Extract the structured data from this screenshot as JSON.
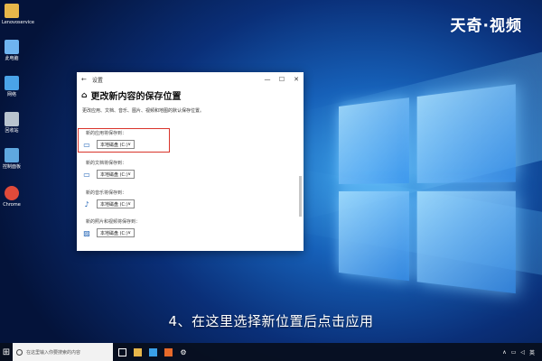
{
  "brand": "天奇·视频",
  "desktop_icons": [
    {
      "label": "Lenovoservice",
      "color": "#e8b74a"
    },
    {
      "label": "此电脑",
      "color": "#6fb4f0"
    },
    {
      "label": "网络",
      "color": "#4aa3e8"
    },
    {
      "label": "回收站",
      "color": "#b9c4cf"
    },
    {
      "label": "控制面板",
      "color": "#5fa8e0"
    },
    {
      "label": "Chrome",
      "color": "#e04a3a"
    }
  ],
  "window": {
    "title": "设置",
    "heading": "更改新内容的保存位置",
    "description": "更改应用、文档、音乐、图片、视频和地图的默认保存位置。",
    "sections": [
      {
        "label": "新的应用将保存到：",
        "value": "本地磁盘 (C:)",
        "icon": "monitor-icon"
      },
      {
        "label": "新的文档将保存到：",
        "value": "本地磁盘 (C:)",
        "icon": "folder-icon"
      },
      {
        "label": "新的音乐将保存到：",
        "value": "本地磁盘 (C:)",
        "icon": "music-icon"
      },
      {
        "label": "新的照片和视频将保存到：",
        "value": "本地磁盘 (C:)",
        "icon": "image-icon"
      }
    ]
  },
  "caption": "4、在这里选择新位置后点击应用",
  "taskbar": {
    "search_placeholder": "在这里输入你要搜索的内容",
    "tray_time": "",
    "lang": "英"
  }
}
